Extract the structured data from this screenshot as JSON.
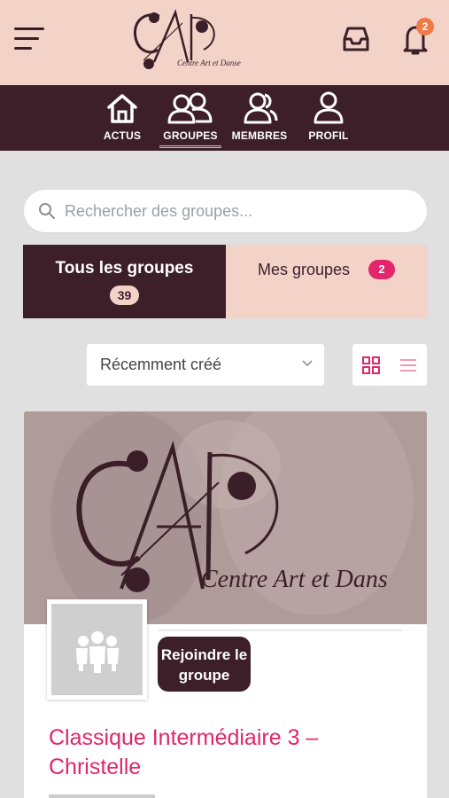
{
  "header": {
    "logo": {
      "monogram": "CAD",
      "name": "Centre Art et Danse"
    },
    "notification_count": "2"
  },
  "nav": {
    "items": [
      {
        "label": "ACTUS",
        "icon": "home-icon",
        "active": false
      },
      {
        "label": "GROUPES",
        "icon": "groups-icon",
        "active": true
      },
      {
        "label": "MEMBRES",
        "icon": "members-icon",
        "active": false
      },
      {
        "label": "PROFIL",
        "icon": "profile-icon",
        "active": false
      }
    ]
  },
  "search": {
    "placeholder": "Rechercher des groupes..."
  },
  "tabs": {
    "all": {
      "label": "Tous les groupes",
      "count": "39"
    },
    "mine": {
      "label": "Mes groupes",
      "count": "2"
    }
  },
  "filters": {
    "sort_selected": "Récemment créé",
    "view_modes": [
      "grid",
      "list"
    ],
    "active_view": "grid"
  },
  "groups": [
    {
      "cover": {
        "monogram": "CAD",
        "name": "Centre Art et Danse"
      },
      "join_label": "Rejoindre le groupe",
      "title": "Classique Intermédiaire 3 – Christelle"
    }
  ],
  "colors": {
    "brand_dark": "#3d1f2a",
    "brand_light": "#f3d3c8",
    "accent_pink": "#e3256b",
    "badge_orange": "#f07a45"
  }
}
